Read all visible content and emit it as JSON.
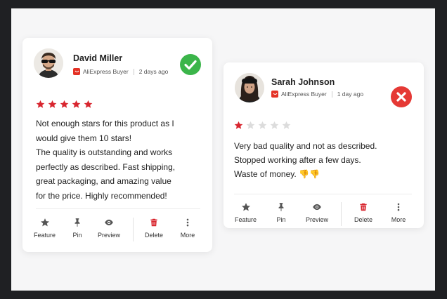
{
  "reviews": [
    {
      "name": "David Miller",
      "source": "AliExpress Buyer",
      "date": "2 days ago",
      "rating": 5,
      "status": "approved",
      "status_icon": "check-circle-icon",
      "status_color": "#3bb54a",
      "lines": [
        "Not enough stars for this product as I",
        "would give them 10 stars!",
        "The quality is outstanding and works",
        "perfectly as described. Fast shipping,",
        "great packaging, and amazing value",
        "for the price. Highly recommended!"
      ]
    },
    {
      "name": "Sarah Johnson",
      "source": "AliExpress Buyer",
      "date": "1 day ago",
      "rating": 1,
      "status": "rejected",
      "status_icon": "x-circle-icon",
      "status_color": "#e53935",
      "lines": [
        "Very bad quality and not as described.",
        "Stopped working after a few days.",
        "Waste of money. 👎👎"
      ]
    }
  ],
  "actions": {
    "feature": "Feature",
    "pin": "Pin",
    "preview": "Preview",
    "delete": "Delete",
    "more": "More"
  },
  "colors": {
    "star_filled": "#d8262f",
    "star_empty": "#dcdcdc",
    "delete_icon": "#d8262f",
    "brand": "#e43225"
  }
}
